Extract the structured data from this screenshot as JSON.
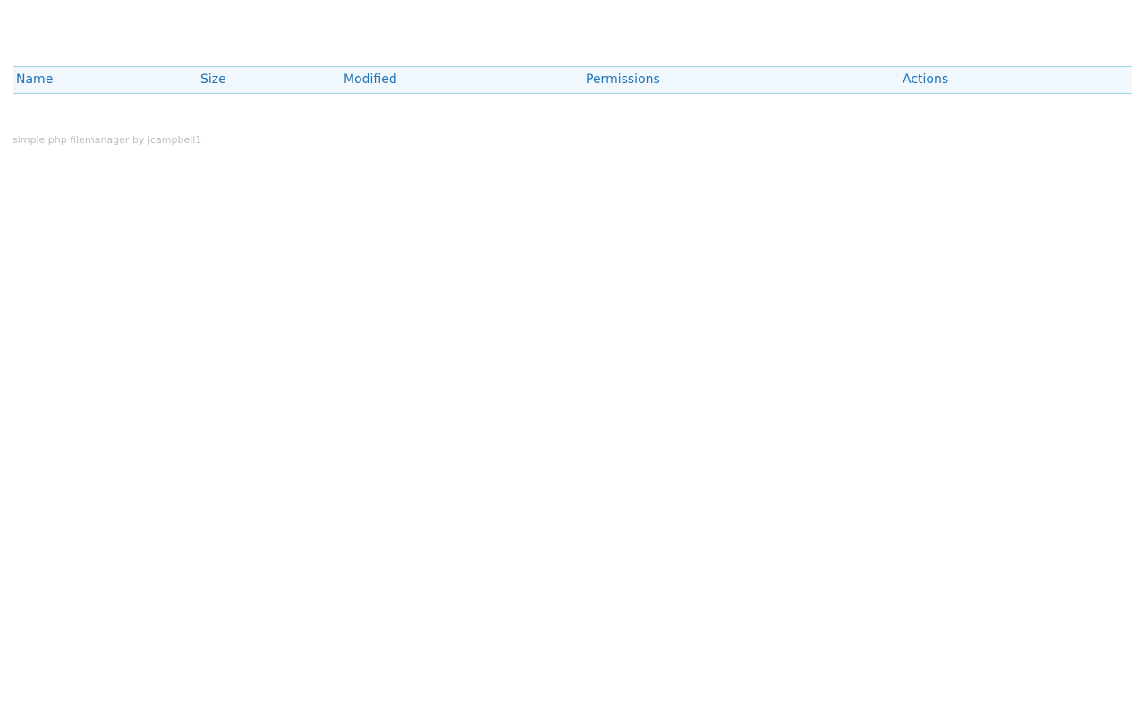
{
  "listing": {
    "columns": [
      {
        "label": "Name"
      },
      {
        "label": "Size"
      },
      {
        "label": "Modified"
      },
      {
        "label": "Permissions"
      },
      {
        "label": "Actions"
      }
    ],
    "rows": []
  },
  "footer": {
    "text": "simple php filemanager by",
    "author": "jcampbell1"
  },
  "colors": {
    "header_text": "#1f73b8",
    "header_bg": "#f0f7fd",
    "header_border": "#9fd1e8",
    "footer_text": "#b9bcc2"
  }
}
